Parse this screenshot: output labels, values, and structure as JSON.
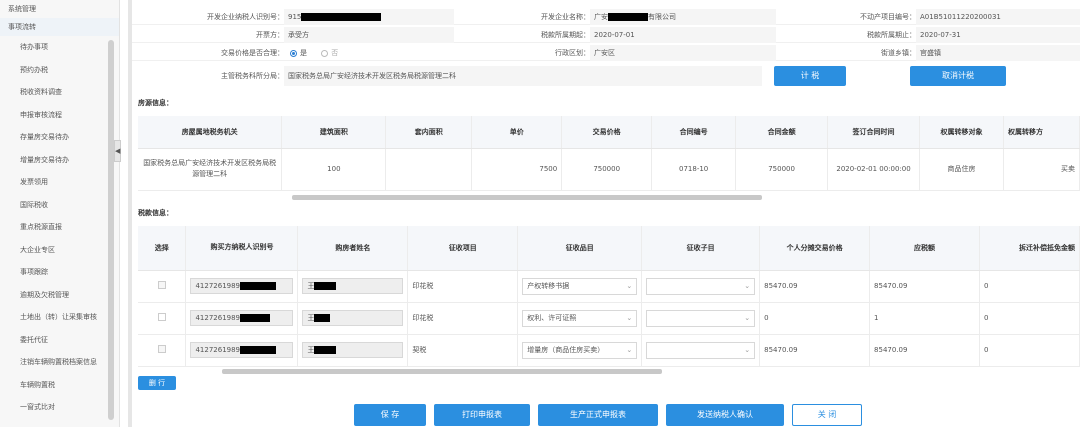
{
  "sidebar": {
    "top_items": [
      "系统管理",
      "事项流转"
    ],
    "sub_items": [
      "待办事项",
      "预约办税",
      "税收资料调查",
      "申报审核流程",
      "存量房交易待办",
      "增量房交易待办",
      "发票领用",
      "国际税收",
      "重点税源直报",
      "大企业专区",
      "事项跟踪",
      "逾期及欠税管理",
      "土地出（转）让采集审核",
      "委托代征",
      "注销车辆购置税档案信息",
      "车辆购置税",
      "一窗式比对"
    ],
    "collapse_glyph": "◀"
  },
  "info": {
    "dev_taxpayer_id_label": "开发企业纳税人识别号：",
    "dev_taxpayer_id_value": "915",
    "dev_name_label": "开发企业名称：",
    "dev_name_prefix": "广安",
    "dev_name_suffix": "有限公司",
    "property_no_label": "不动产项目编号：",
    "property_no_value": "A01B51011220200031",
    "invoice_party_label": "开票方：",
    "invoice_party_value": "承受方",
    "period_start_label": "税款所属期起：",
    "period_start_value": "2020-07-01",
    "period_end_label": "税款所属期止：",
    "period_end_value": "2020-07-31",
    "fair_price_label": "交易价格是否合理：",
    "fair_yes": "是",
    "fair_no": "否",
    "district_label": "行政区划：",
    "district_value": "广安区",
    "street_label": "街道乡镇：",
    "street_value": "官盛镇",
    "tax_office_label": "主管税务科所分局：",
    "tax_office_value": "国家税务总局广安经济技术开发区税务局税源管理二科",
    "calc_btn": "计 税",
    "cancel_calc_btn": "取消计税"
  },
  "house": {
    "section_title": "房源信息：",
    "columns": [
      "房屋属地税务机关",
      "建筑面积",
      "套内面积",
      "单价",
      "交易价格",
      "合同编号",
      "合同金额",
      "签订合同时间",
      "权属转移对象",
      "权属转移方"
    ],
    "row": [
      "国家税务总局广安经济技术开发区税务局税源管理二科",
      "100",
      "",
      "7500",
      "750000",
      "0718-10",
      "750000",
      "2020-02-01 00:00:00",
      "商品住房",
      "买卖"
    ]
  },
  "tax": {
    "section_title": "税款信息：",
    "columns": [
      "选择",
      "购买方纳税人识别号",
      "购房者姓名",
      "征收项目",
      "征收品目",
      "征收子目",
      "个人分摊交易价格",
      "应税额",
      "拆迁补偿抵免金额"
    ],
    "rows": [
      {
        "taxpayer_id": "4127261989",
        "name": "王",
        "item": "印花税",
        "category": "产权转移书据",
        "price": "85470.09",
        "tax": "85470.09",
        "deduct": "0"
      },
      {
        "taxpayer_id": "4127261989",
        "name": "王",
        "item": "印花税",
        "category": "权利、许可证照",
        "price": "0",
        "tax": "1",
        "deduct": "0"
      },
      {
        "taxpayer_id": "4127261989",
        "name": "王",
        "item": "契税",
        "category": "增量房（商品住房买卖）",
        "price": "85470.09",
        "tax": "85470.09",
        "deduct": "0"
      }
    ],
    "chevron": "⌄",
    "del_btn": "删 行"
  },
  "actions": {
    "save": "保 存",
    "print": "打印申报表",
    "generate": "生产正式申报表",
    "send": "发送纳税人确认",
    "close": "关 闭"
  }
}
